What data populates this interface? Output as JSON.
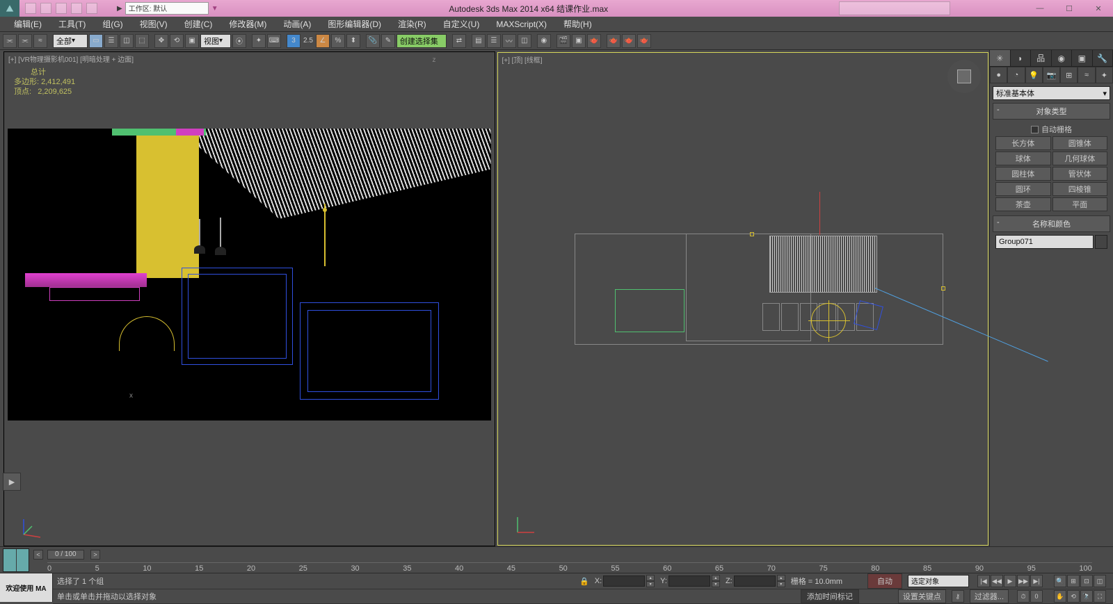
{
  "title": "Autodesk 3ds Max  2014 x64     结课作业.max",
  "workspace": {
    "label": "工作区: 默认"
  },
  "menu": [
    "编辑(E)",
    "工具(T)",
    "组(G)",
    "视图(V)",
    "创建(C)",
    "修改器(M)",
    "动画(A)",
    "图形编辑器(D)",
    "渲染(R)",
    "自定义(U)",
    "MAXScript(X)",
    "帮助(H)"
  ],
  "toolbar": {
    "selset_label": "全部",
    "refcoord": "视图",
    "namesel": "创建选择集",
    "snap_angle": "2.5"
  },
  "viewport1": {
    "label": "[+] [VR物理摄影机001] [明暗处理 + 边面]",
    "stats_head": "总计",
    "polys_label": "多边形:",
    "polys": "2,412,491",
    "verts_label": "顶点:",
    "verts": "2,209,625",
    "axis_x": "x",
    "axis_z": "z"
  },
  "viewport2": {
    "label": "[+] [顶] [线框]"
  },
  "cmdpanel": {
    "category": "标准基本体",
    "rollout_objtype": "对象类型",
    "autogrid": "自动栅格",
    "buttons": [
      [
        "长方体",
        "圆锥体"
      ],
      [
        "球体",
        "几何球体"
      ],
      [
        "圆柱体",
        "管状体"
      ],
      [
        "圆环",
        "四棱锥"
      ],
      [
        "茶壶",
        "平面"
      ]
    ],
    "rollout_name": "名称和颜色",
    "objname": "Group071"
  },
  "timeline": {
    "frame": "0 / 100",
    "ticks": [
      "0",
      "5",
      "10",
      "15",
      "20",
      "25",
      "30",
      "35",
      "40",
      "45",
      "50",
      "55",
      "60",
      "65",
      "70",
      "75",
      "80",
      "85",
      "90",
      "95",
      "100"
    ]
  },
  "status": {
    "welcome": "欢迎使用 MA",
    "sel": "选择了 1 个组",
    "hint": "单击或单击并拖动以选择对象",
    "x": "X:",
    "y": "Y:",
    "z": "Z:",
    "grid": "栅格 = 10.0mm",
    "auto": "自动",
    "selfilter": "选定对象",
    "addtime": "添加时间标记",
    "setkey": "设置关键点",
    "filter": "过滤器..."
  }
}
